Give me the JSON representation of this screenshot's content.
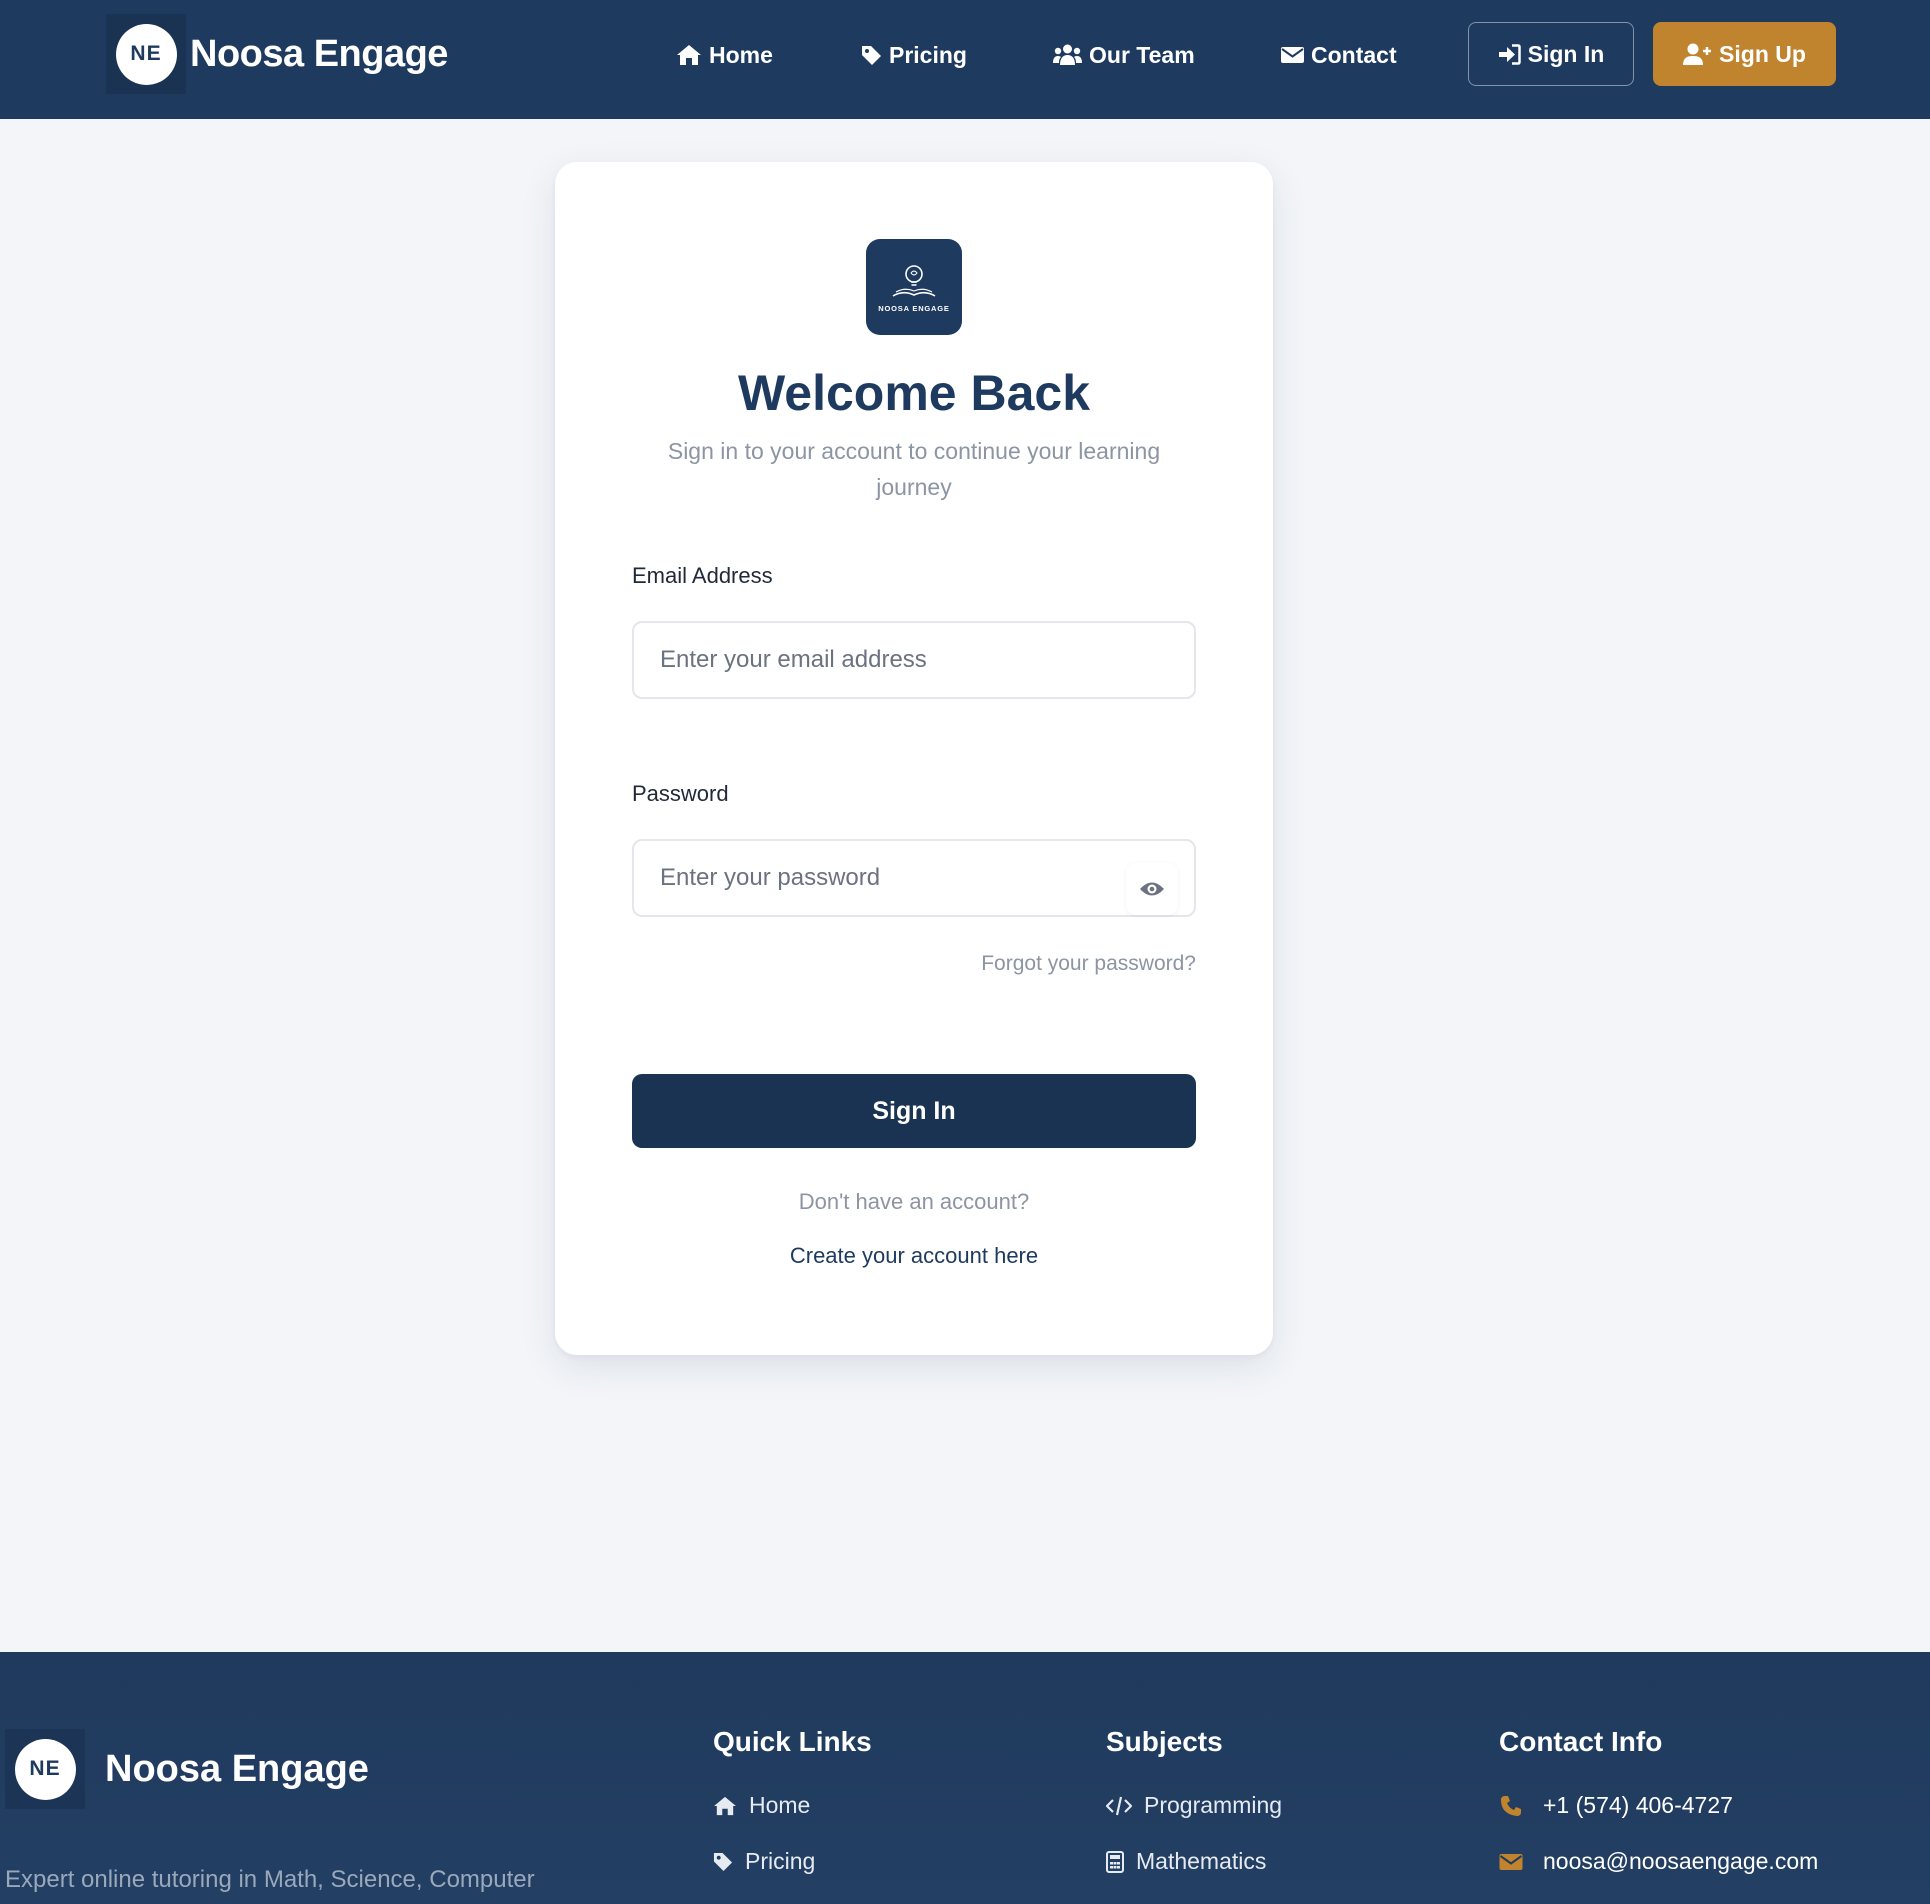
{
  "nav": {
    "brand_initials": "NE",
    "brand_name": "Noosa Engage",
    "links": [
      {
        "label": "Home",
        "icon": "home-icon"
      },
      {
        "label": "Pricing",
        "icon": "tag-icon"
      },
      {
        "label": "Our Team",
        "icon": "users-icon"
      },
      {
        "label": "Contact",
        "icon": "envelope-icon"
      }
    ],
    "signin_label": "Sign In",
    "signup_label": "Sign Up"
  },
  "login": {
    "logo_text": "NOOSA ENGAGE",
    "title": "Welcome Back",
    "subtitle": "Sign in to your account to continue your learning journey",
    "email_label": "Email Address",
    "email_placeholder": "Enter your email address",
    "password_label": "Password",
    "password_placeholder": "Enter your password",
    "forgot_label": "Forgot your password?",
    "submit_label": "Sign In",
    "no_account_text": "Don't have an account?",
    "create_account_label": "Create your account here"
  },
  "footer": {
    "brand_initials": "NE",
    "brand_name": "Noosa Engage",
    "description": "Expert online tutoring in Math, Science, Computer",
    "quick_links": {
      "heading": "Quick Links",
      "items": [
        {
          "label": "Home",
          "icon": "home-icon"
        },
        {
          "label": "Pricing",
          "icon": "tag-icon"
        }
      ]
    },
    "subjects": {
      "heading": "Subjects",
      "items": [
        {
          "label": "Programming",
          "icon": "code-icon"
        },
        {
          "label": "Mathematics",
          "icon": "calculator-icon"
        }
      ]
    },
    "contact": {
      "heading": "Contact Info",
      "phone": "+1 (574) 406-4727",
      "email": "noosa@noosaengage.com"
    }
  },
  "colors": {
    "navy": "#1e3a5f",
    "accent": "#c0842e",
    "background": "#f3f5f8"
  }
}
